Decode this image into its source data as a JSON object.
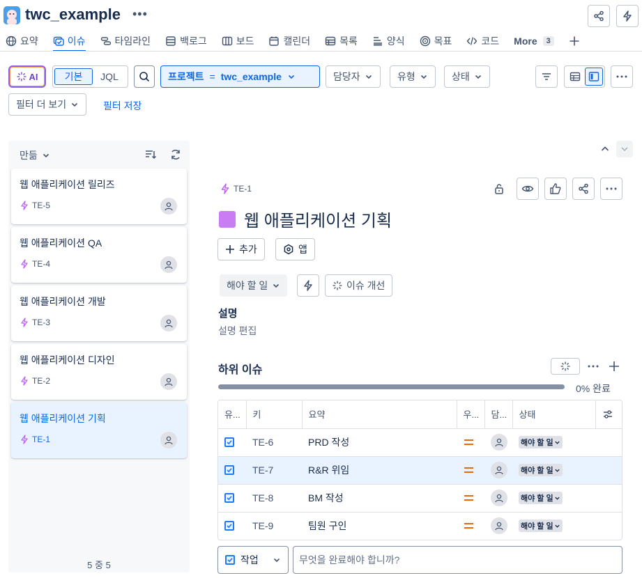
{
  "project": {
    "name": "twc_example"
  },
  "nav": {
    "tabs": [
      {
        "label": "요약",
        "icon": "globe-icon"
      },
      {
        "label": "이슈",
        "icon": "issues-icon",
        "active": true
      },
      {
        "label": "타임라인",
        "icon": "timeline-icon"
      },
      {
        "label": "백로그",
        "icon": "backlog-icon"
      },
      {
        "label": "보드",
        "icon": "board-icon"
      },
      {
        "label": "캘린더",
        "icon": "calendar-icon"
      },
      {
        "label": "목록",
        "icon": "list-icon"
      },
      {
        "label": "양식",
        "icon": "form-icon"
      },
      {
        "label": "목표",
        "icon": "goal-icon"
      },
      {
        "label": "코드",
        "icon": "code-icon"
      }
    ],
    "more_label": "More",
    "more_count": "3"
  },
  "filters": {
    "ai_label": "AI",
    "basic_label": "기본",
    "jql_label": "JQL",
    "project_label": "프로젝트",
    "project_op": "=",
    "project_value": "twc_example",
    "assignee_label": "담당자",
    "type_label": "유형",
    "status_label": "상태",
    "more_filters_label": "필터 더 보기",
    "save_filter_label": "필터 저장"
  },
  "list": {
    "sort_label": "만듦",
    "items": [
      {
        "title": "웹 애플리케이션 릴리즈",
        "key": "TE-5"
      },
      {
        "title": "웹 애플리케이션 QA",
        "key": "TE-4"
      },
      {
        "title": "웹 애플리케이션 개발",
        "key": "TE-3"
      },
      {
        "title": "웹 애플리케이션 디자인",
        "key": "TE-2"
      },
      {
        "title": "웹 애플리케이션 기획",
        "key": "TE-1",
        "selected": true
      }
    ],
    "count_text": "5 중 5"
  },
  "detail": {
    "key": "TE-1",
    "title": "웹 애플리케이션 기획",
    "type_color": "#c97cf4",
    "add_label": "추가",
    "apps_label": "앱",
    "status_label": "해야 할 일",
    "improve_label": "이슈 개선",
    "description_heading": "설명",
    "description_placeholder": "설명 편집",
    "subtasks": {
      "heading": "하위 이슈",
      "progress_percent": 0,
      "progress_text": "0% 완료",
      "columns": [
        "유...",
        "키",
        "요약",
        "우...",
        "담...",
        "상태"
      ],
      "rows": [
        {
          "key": "TE-6",
          "summary": "PRD 작성",
          "status": "해야 할 일"
        },
        {
          "key": "TE-7",
          "summary": "R&R 위임",
          "status": "해야 할 일",
          "highlighted": true
        },
        {
          "key": "TE-8",
          "summary": "BM 작성",
          "status": "해야 할 일"
        },
        {
          "key": "TE-9",
          "summary": "팀원 구인",
          "status": "해야 할 일"
        }
      ]
    },
    "create": {
      "type_label": "작업",
      "placeholder": "무엇을 완료해야 합니까?"
    }
  },
  "colors": {
    "accent": "#0c66e4",
    "priority_medium": "#e56910",
    "epic_purple": "#c97cf4"
  }
}
